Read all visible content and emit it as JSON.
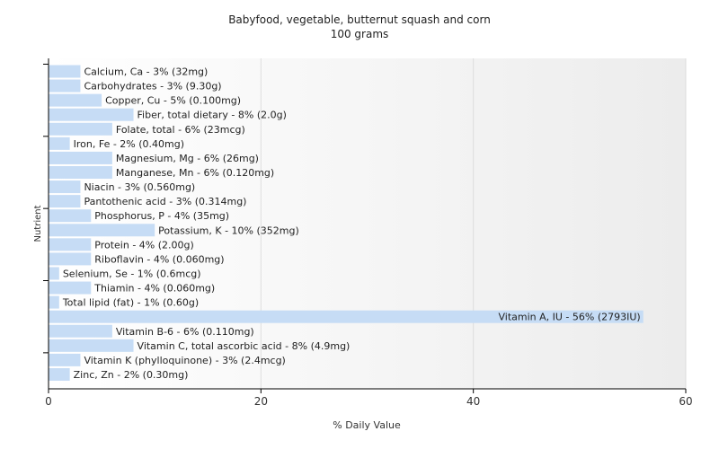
{
  "chart_data": {
    "type": "bar",
    "orientation": "horizontal",
    "title": "Babyfood, vegetable, butternut squash and corn",
    "subtitle": "100 grams",
    "xlabel": "% Daily Value",
    "ylabel": "Nutrient",
    "xlim": [
      0,
      60
    ],
    "xticks": [
      0,
      20,
      40,
      60
    ],
    "grid": true,
    "bar_color": "#c6dcf5",
    "bars": [
      {
        "name": "Calcium, Ca",
        "value": 3,
        "label": "Calcium, Ca - 3% (32mg)"
      },
      {
        "name": "Carbohydrates",
        "value": 3,
        "label": "Carbohydrates - 3% (9.30g)"
      },
      {
        "name": "Copper, Cu",
        "value": 5,
        "label": "Copper, Cu - 5% (0.100mg)"
      },
      {
        "name": "Fiber, total dietary",
        "value": 8,
        "label": "Fiber, total dietary - 8% (2.0g)"
      },
      {
        "name": "Folate, total",
        "value": 6,
        "label": "Folate, total - 6% (23mcg)"
      },
      {
        "name": "Iron, Fe",
        "value": 2,
        "label": "Iron, Fe - 2% (0.40mg)"
      },
      {
        "name": "Magnesium, Mg",
        "value": 6,
        "label": "Magnesium, Mg - 6% (26mg)"
      },
      {
        "name": "Manganese, Mn",
        "value": 6,
        "label": "Manganese, Mn - 6% (0.120mg)"
      },
      {
        "name": "Niacin",
        "value": 3,
        "label": "Niacin - 3% (0.560mg)"
      },
      {
        "name": "Pantothenic acid",
        "value": 3,
        "label": "Pantothenic acid - 3% (0.314mg)"
      },
      {
        "name": "Phosphorus, P",
        "value": 4,
        "label": "Phosphorus, P - 4% (35mg)"
      },
      {
        "name": "Potassium, K",
        "value": 10,
        "label": "Potassium, K - 10% (352mg)"
      },
      {
        "name": "Protein",
        "value": 4,
        "label": "Protein - 4% (2.00g)"
      },
      {
        "name": "Riboflavin",
        "value": 4,
        "label": "Riboflavin - 4% (0.060mg)"
      },
      {
        "name": "Selenium, Se",
        "value": 1,
        "label": "Selenium, Se - 1% (0.6mcg)"
      },
      {
        "name": "Thiamin",
        "value": 4,
        "label": "Thiamin - 4% (0.060mg)"
      },
      {
        "name": "Total lipid (fat)",
        "value": 1,
        "label": "Total lipid (fat) - 1% (0.60g)"
      },
      {
        "name": "Vitamin A, IU",
        "value": 56,
        "label": "Vitamin A, IU - 56% (2793IU)"
      },
      {
        "name": "Vitamin B-6",
        "value": 6,
        "label": "Vitamin B-6 - 6% (0.110mg)"
      },
      {
        "name": "Vitamin C, total ascorbic acid",
        "value": 8,
        "label": "Vitamin C, total ascorbic acid - 8% (4.9mg)"
      },
      {
        "name": "Vitamin K (phylloquinone)",
        "value": 3,
        "label": "Vitamin K (phylloquinone) - 3% (2.4mcg)"
      },
      {
        "name": "Zinc, Zn",
        "value": 2,
        "label": "Zinc, Zn - 2% (0.30mg)"
      }
    ]
  }
}
